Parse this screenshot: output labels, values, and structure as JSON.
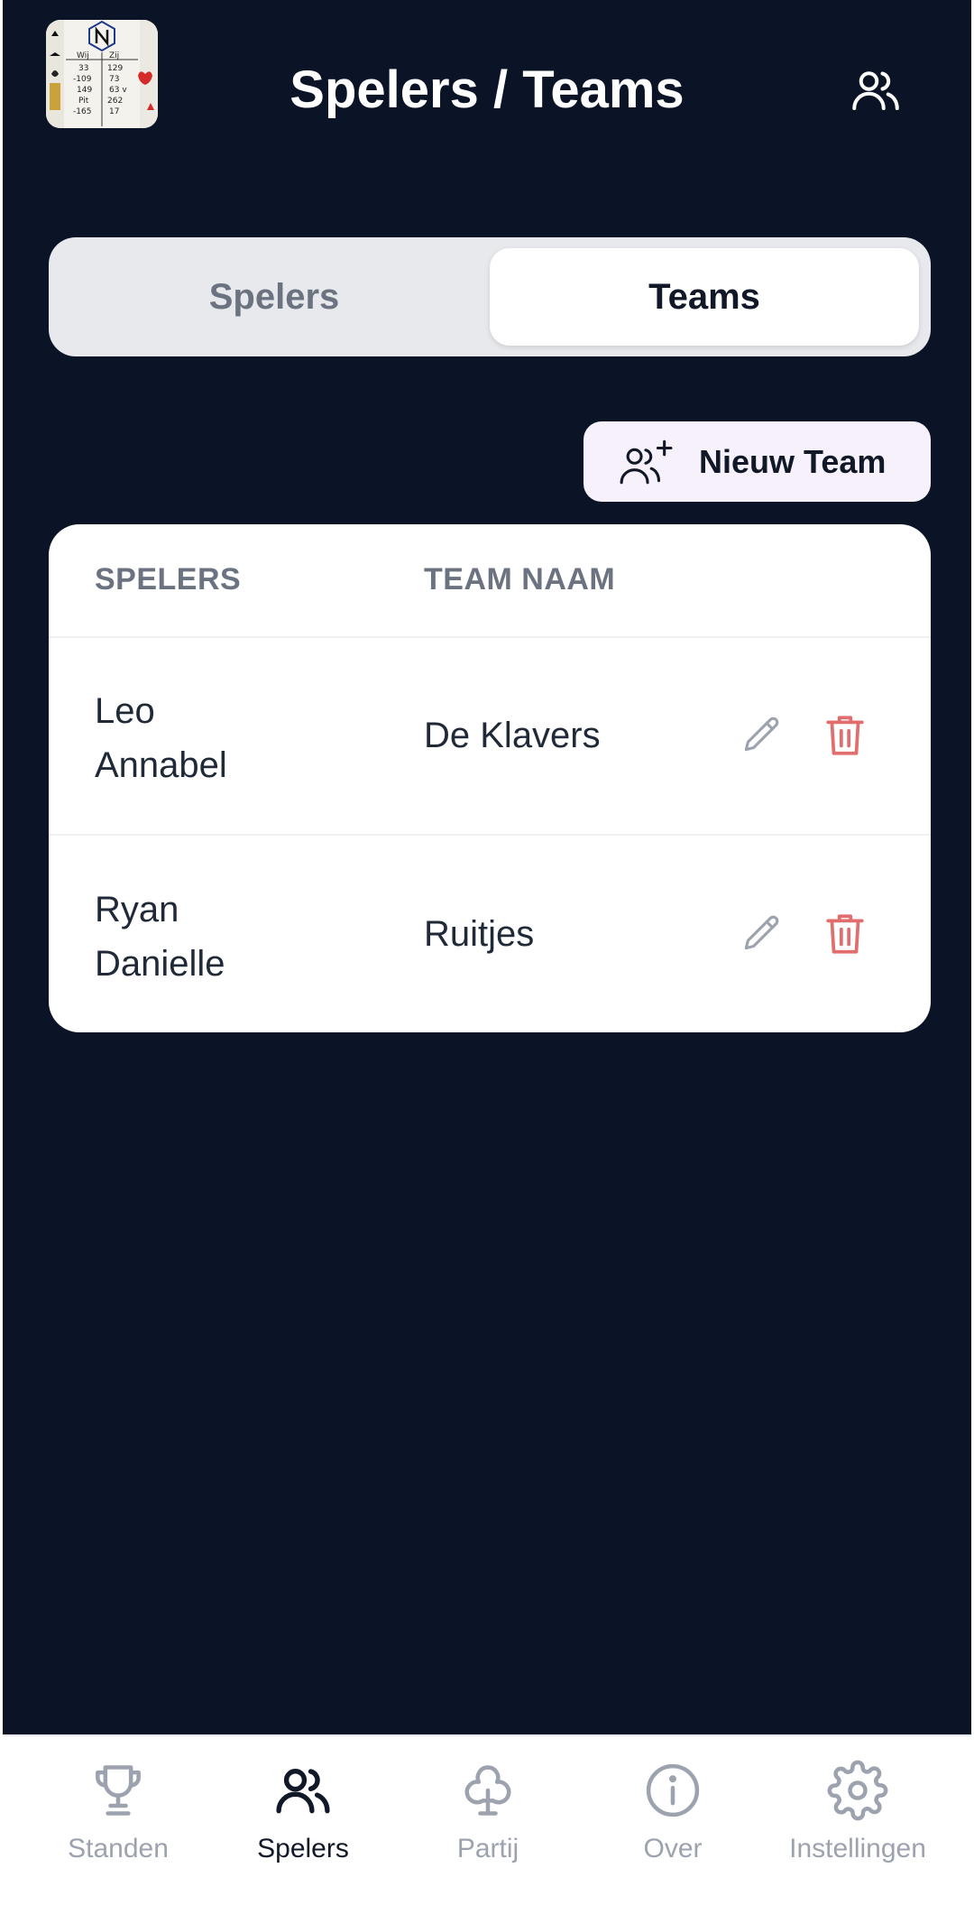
{
  "header": {
    "title": "Spelers / Teams",
    "logo_icon": "scoresheet-cards-logo",
    "right_icon": "users-icon"
  },
  "segment": {
    "left_label": "Spelers",
    "right_label": "Teams",
    "selected": "Teams"
  },
  "actions": {
    "new_team_label": "Nieuw Team",
    "new_team_icon": "users-plus-icon"
  },
  "table": {
    "columns": [
      "SPELERS",
      "TEAM NAAM"
    ],
    "rows": [
      {
        "players": [
          "Leo",
          "Annabel"
        ],
        "team": "De Klavers"
      },
      {
        "players": [
          "Ryan",
          "Danielle"
        ],
        "team": "Ruitjes"
      }
    ]
  },
  "nav": {
    "items": [
      {
        "label": "Standen",
        "icon": "trophy-icon"
      },
      {
        "label": "Spelers",
        "icon": "users-icon"
      },
      {
        "label": "Partij",
        "icon": "club-icon"
      },
      {
        "label": "Over",
        "icon": "info-icon"
      },
      {
        "label": "Instellingen",
        "icon": "gear-icon"
      }
    ],
    "active": "Spelers"
  },
  "colors": {
    "background": "#0b1426",
    "card": "#ffffff",
    "delete": "#e26d6d",
    "muted": "#9ca3af",
    "accent_button": "#f6f1fb"
  }
}
